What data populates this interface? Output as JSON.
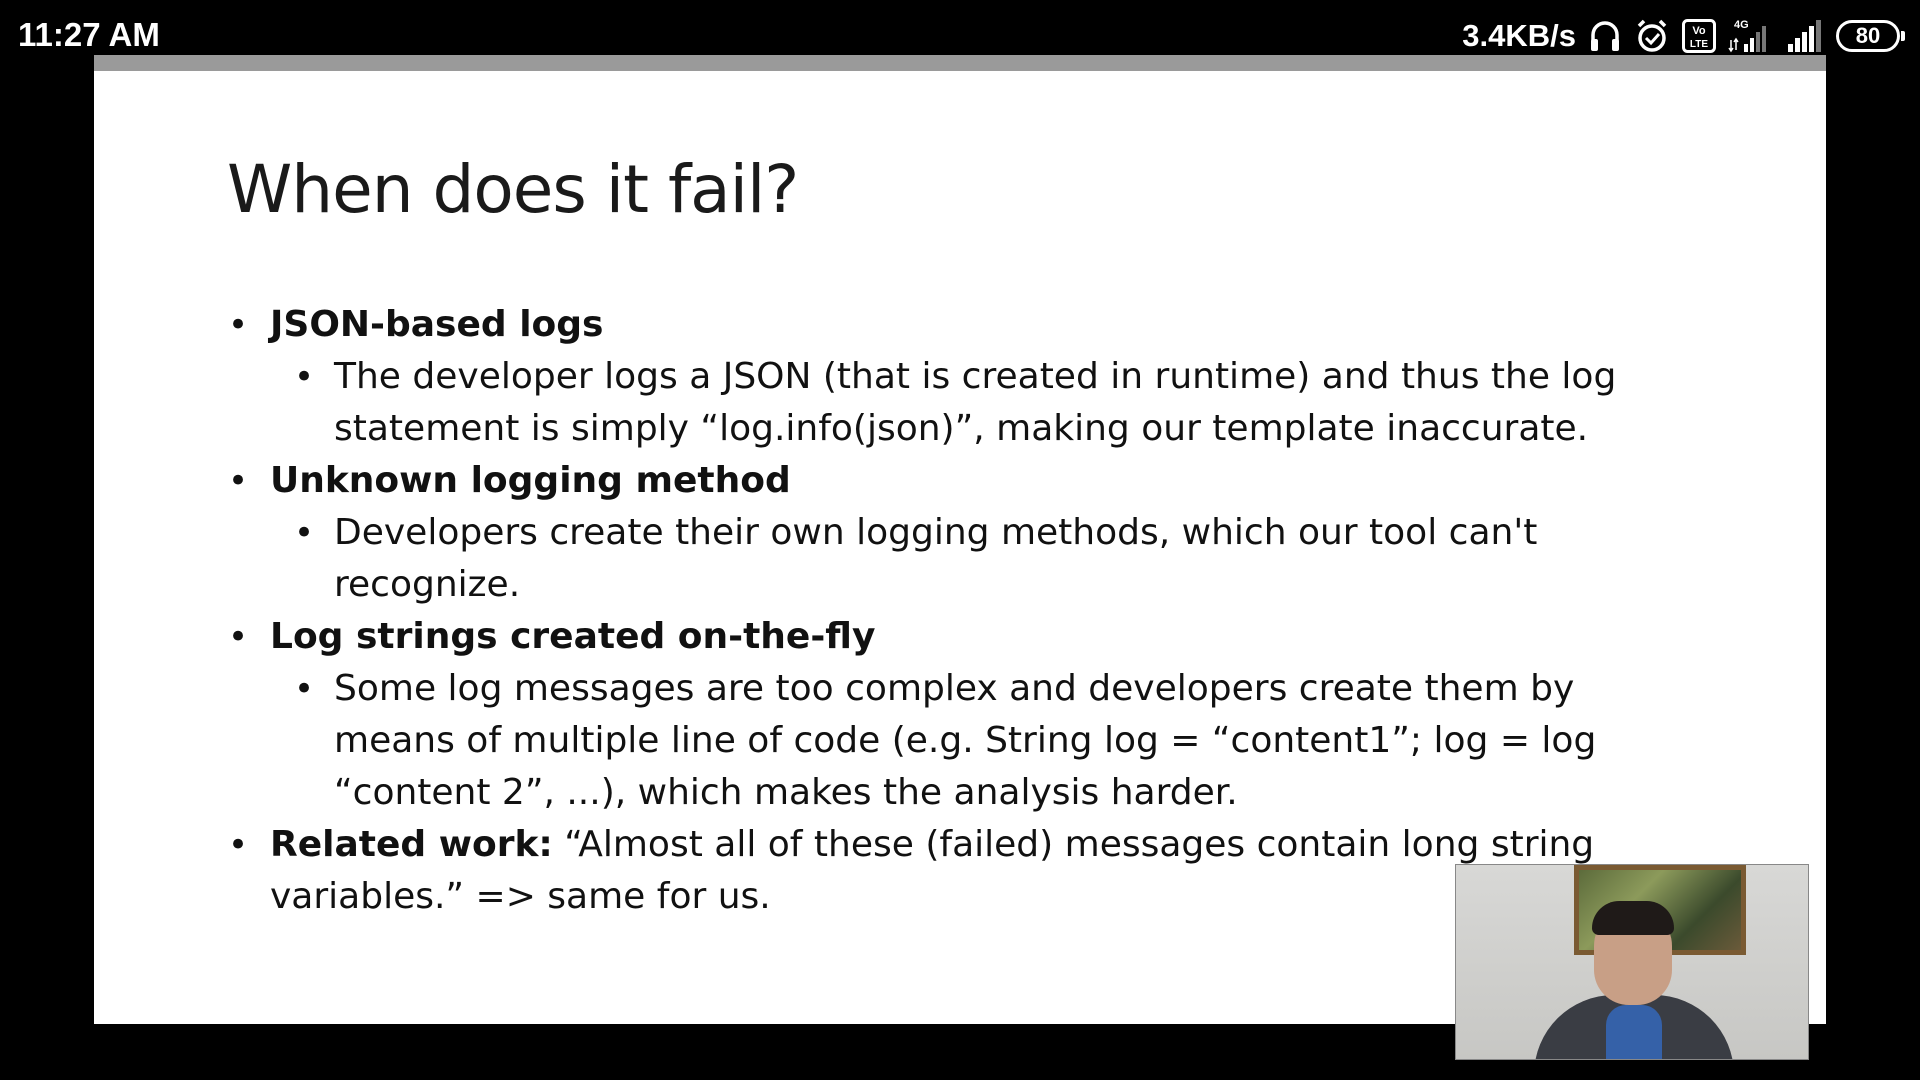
{
  "status_bar": {
    "time": "11:27 AM",
    "net_speed": "3.4KB/s",
    "icons": [
      "headphones-icon",
      "alarm-icon",
      "volte-icon",
      "signal-4g-icon",
      "signal-icon"
    ],
    "network_type": "4G",
    "volte_label": "Vo LTE",
    "battery_level": "80"
  },
  "slide": {
    "title": "When does it fail?",
    "bullets": [
      {
        "title": "JSON-based logs",
        "sub": [
          "The developer logs a JSON (that is created in runtime) and thus the log statement is simply “log.info(json)”, making our template inaccurate."
        ]
      },
      {
        "title": "Unknown logging method",
        "sub": [
          "Developers create their own logging methods, which our tool can't recognize."
        ]
      },
      {
        "title": "Log strings created on-the-fly",
        "sub": [
          "Some log messages are too complex and developers create them by means of multiple line of code (e.g. String log = “content1”; log = log “content 2”, ...), which makes the analysis harder."
        ]
      },
      {
        "title": "Related work:",
        "text": " “Almost all of these (failed) messages contain long string variables.” => same for us."
      }
    ]
  }
}
